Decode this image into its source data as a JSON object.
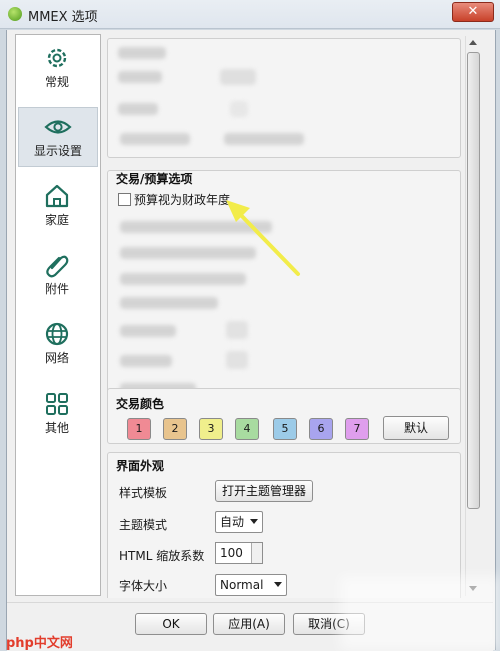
{
  "window": {
    "title": "MMEX 选项",
    "close_glyph": "✕"
  },
  "sidebar": {
    "items": [
      {
        "label": "常规",
        "icon": "gear-icon"
      },
      {
        "label": "显示设置",
        "icon": "eye-icon",
        "active": true
      },
      {
        "label": "家庭",
        "icon": "home-icon"
      },
      {
        "label": "附件",
        "icon": "paperclip-icon"
      },
      {
        "label": "网络",
        "icon": "globe-icon"
      },
      {
        "label": "其他",
        "icon": "grid-icon"
      }
    ]
  },
  "sections": {
    "transaction_budget": {
      "title": "交易/预算选项",
      "fiscal_year_checkbox": {
        "label": "预算视为财政年度",
        "checked": false
      }
    },
    "transaction_colors": {
      "title": "交易颜色",
      "buttons": [
        {
          "label": "1",
          "color": "#f08a94"
        },
        {
          "label": "2",
          "color": "#e8c48e"
        },
        {
          "label": "3",
          "color": "#f0ef8c"
        },
        {
          "label": "4",
          "color": "#a8dba0"
        },
        {
          "label": "5",
          "color": "#9ccbe8"
        },
        {
          "label": "6",
          "color": "#a8a4ee"
        },
        {
          "label": "7",
          "color": "#df9eed"
        }
      ],
      "default_button": "默认"
    },
    "appearance": {
      "title": "界面外观",
      "style_template_label": "样式模板",
      "open_theme_manager_button": "打开主题管理器",
      "theme_mode_label": "主题模式",
      "theme_mode_value": "自动",
      "html_zoom_label": "HTML 缩放系数",
      "html_zoom_value": "100",
      "font_size_label": "字体大小",
      "font_size_value": "Normal"
    }
  },
  "footer": {
    "ok": "OK",
    "apply": "应用(A)",
    "cancel": "取消(C)"
  },
  "annotation": {
    "arrow_color": "#f2ec4a"
  },
  "watermark": {
    "site": "php中文网"
  }
}
